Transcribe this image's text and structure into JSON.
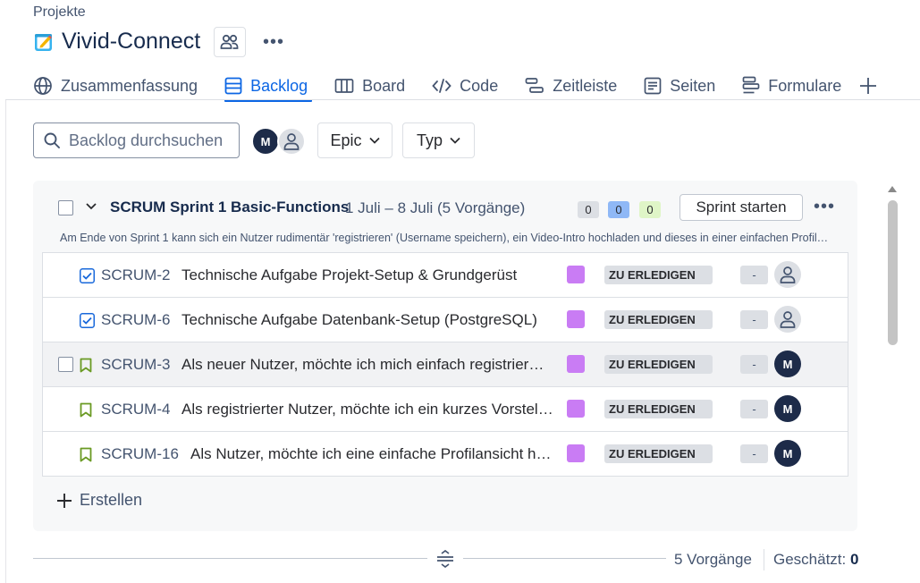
{
  "breadcrumb": "Projekte",
  "project": {
    "title": "Vivid-Connect"
  },
  "tabs": [
    {
      "label": "Zusammenfassung",
      "icon": "globe-icon"
    },
    {
      "label": "Backlog",
      "icon": "backlog-icon",
      "active": true
    },
    {
      "label": "Board",
      "icon": "board-icon"
    },
    {
      "label": "Code",
      "icon": "code-icon"
    },
    {
      "label": "Zeitleiste",
      "icon": "timeline-icon"
    },
    {
      "label": "Seiten",
      "icon": "pages-icon"
    },
    {
      "label": "Formulare",
      "icon": "forms-icon"
    }
  ],
  "toolbar": {
    "search_placeholder": "Backlog durchsuchen",
    "avatar_initial": "M",
    "epic_label": "Epic",
    "typ_label": "Typ"
  },
  "sprint": {
    "name": "SCRUM Sprint 1 Basic-Functions",
    "dates": "1 Juli – 8 Juli (5 Vorgänge)",
    "counts": {
      "todo": "0",
      "in_progress": "0",
      "done": "0"
    },
    "start_label": "Sprint starten",
    "goal": "Am Ende von Sprint 1 kann sich ein Nutzer rudimentär 'registrieren' (Username speichern), ein Video-Intro hochladen und dieses in einer einfachen Profilansicht sehen."
  },
  "issues": [
    {
      "key": "SCRUM-2",
      "summary": "Technische Aufgabe Projekt-Setup & Grundgerüst",
      "type": "task",
      "status": "ZU ERLEDIGEN",
      "estimate": "-",
      "assignee": ""
    },
    {
      "key": "SCRUM-6",
      "summary": "Technische Aufgabe Datenbank-Setup (PostgreSQL)",
      "type": "task",
      "status": "ZU ERLEDIGEN",
      "estimate": "-",
      "assignee": ""
    },
    {
      "key": "SCRUM-3",
      "summary": "Als neuer Nutzer, möchte ich mich einfach registrieren können",
      "type": "story",
      "status": "ZU ERLEDIGEN",
      "estimate": "-",
      "assignee": "M"
    },
    {
      "key": "SCRUM-4",
      "summary": "Als registrierter Nutzer, möchte ich ein kurzes Vorstellungsvideo hochladen",
      "type": "story",
      "status": "ZU ERLEDIGEN",
      "estimate": "-",
      "assignee": "M"
    },
    {
      "key": "SCRUM-16",
      "summary": "Als Nutzer, möchte ich eine einfache Profilansicht haben",
      "type": "story",
      "status": "ZU ERLEDIGEN",
      "estimate": "-",
      "assignee": "M"
    }
  ],
  "create_label": "Erstellen",
  "footer": {
    "count": "5 Vorgänge",
    "estimated_label": "Geschätzt:",
    "estimated_value": "0"
  },
  "colors": {
    "accent": "#0c66e4",
    "epic": "#c97cf4",
    "task": "#1868db",
    "story": "#6a9a23",
    "avatar": "#1d2b49"
  }
}
